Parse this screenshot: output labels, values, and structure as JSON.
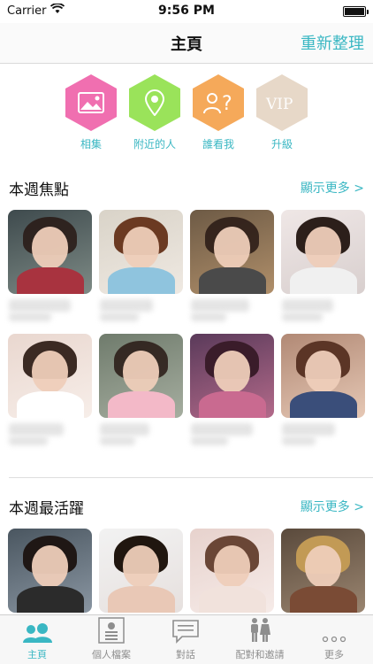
{
  "status": {
    "carrier": "Carrier",
    "time": "9:56 PM"
  },
  "nav": {
    "title": "主頁",
    "action": "重新整理"
  },
  "quick_actions": [
    {
      "label": "相集",
      "icon": "photo-album-icon",
      "color": "#f06fb0"
    },
    {
      "label": "附近的人",
      "icon": "location-pin-icon",
      "color": "#9ae35a"
    },
    {
      "label": "誰看我",
      "icon": "who-viewed-me-icon",
      "color": "#f5a95a"
    },
    {
      "label": "升級",
      "icon": "vip-icon",
      "color": "#e7d8c8"
    }
  ],
  "sections": [
    {
      "title": "本週焦點",
      "more": "顯示更多 >"
    },
    {
      "title": "本週最活躍",
      "more": "顯示更多 >"
    }
  ],
  "tabs": [
    {
      "label": "主頁",
      "icon": "users-icon",
      "active": true
    },
    {
      "label": "個人檔案",
      "icon": "profile-card-icon",
      "active": false
    },
    {
      "label": "對話",
      "icon": "chat-bubble-icon",
      "active": false
    },
    {
      "label": "配對和邀請",
      "icon": "couple-icon",
      "active": false
    },
    {
      "label": "更多",
      "icon": "more-dots-icon",
      "active": false
    }
  ],
  "colors": {
    "accent": "#3ab7c3",
    "tab_inactive": "#8e8e8e"
  }
}
